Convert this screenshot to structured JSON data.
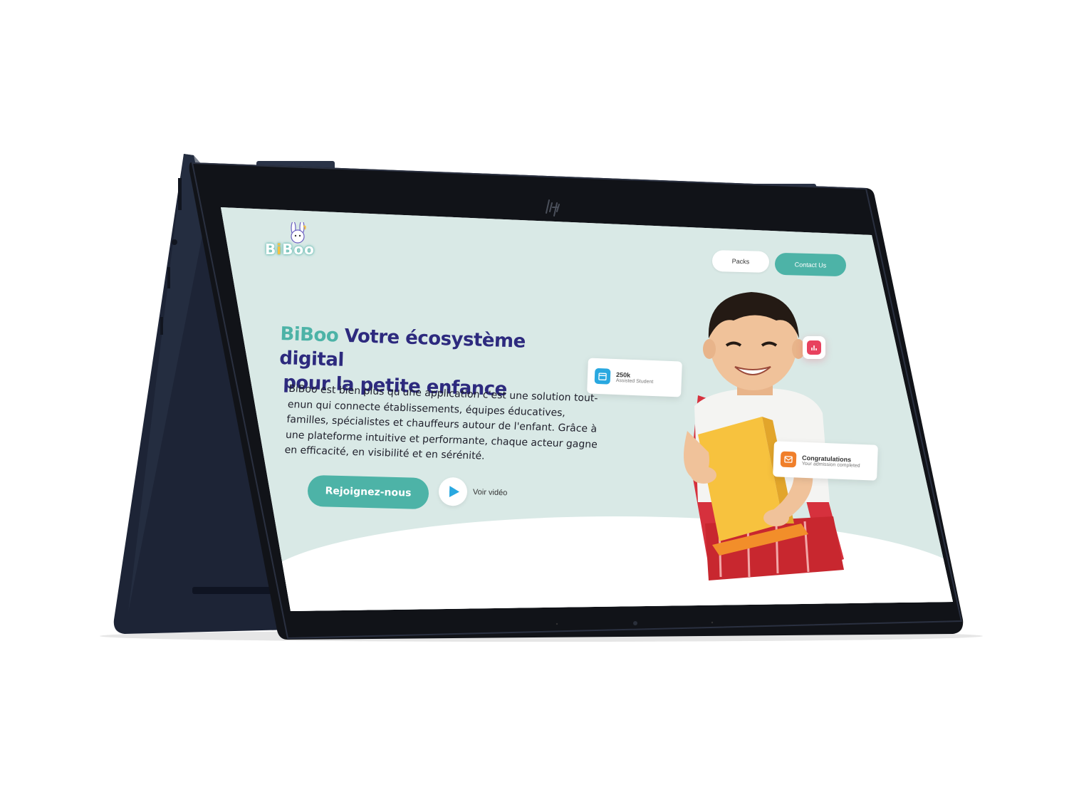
{
  "device": {
    "brand_logo": "hp-logo-icon"
  },
  "site": {
    "logo": {
      "text_part1": "B",
      "text_i": "i",
      "text_part2": "Boo",
      "tagline": ""
    },
    "nav": {
      "packs_label": "Packs",
      "contact_label": "Contact Us"
    },
    "hero": {
      "brand": "BiBoo",
      "title_rest": " Votre écosystème digital",
      "title_line2": "pour la petite enfance",
      "description": "BiBoo est bien plus qu'une application c'est une solution tout-enun qui connecte établissements, équipes éducatives, familles, spécialistes et chauffeurs autour de l'enfant. Grâce à une plateforme intuitive et performante, chaque acteur gagne en efficacité, en visibilité et en sérénité.",
      "cta_join": "Rejoignez-nous",
      "cta_video": "Voir vidéo"
    },
    "cards": {
      "students_value": "250k",
      "students_label": "Assisted Student",
      "congrats_title": "Congratulations",
      "congrats_sub": "Your admission completed"
    },
    "colors": {
      "teal": "#4db3a7",
      "navy": "#2d2a7e",
      "background": "#d9e9e6",
      "pink": "#e8415e",
      "orange": "#f07f2a",
      "sky": "#29a8e0"
    }
  }
}
